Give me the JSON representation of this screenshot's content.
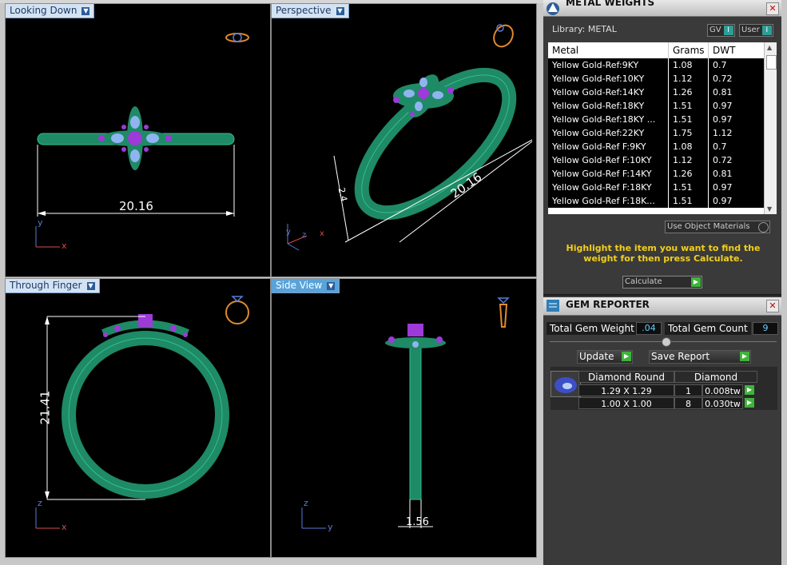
{
  "viewports": [
    {
      "label": "Looking Down",
      "active": false,
      "dimension": "20.16",
      "axes": [
        "y",
        "x"
      ]
    },
    {
      "label": "Perspective",
      "active": false,
      "dimension_a": "20.16",
      "dimension_b": "2.4",
      "axes": [
        "y",
        "z",
        "x"
      ]
    },
    {
      "label": "Through Finger",
      "active": false,
      "dimension": "21.41",
      "axes": [
        "z",
        "x"
      ]
    },
    {
      "label": "Side View",
      "active": true,
      "dimension": "1.56",
      "axes": [
        "z",
        "y"
      ]
    }
  ],
  "metal_panel": {
    "title": "METAL WEIGHTS",
    "library_label": "Library: METAL",
    "toggle_gv": "GV",
    "toggle_user": "User",
    "columns": [
      "Metal",
      "Grams",
      "DWT"
    ],
    "rows": [
      [
        "Yellow Gold-Ref:9KY",
        "1.08",
        "0.7"
      ],
      [
        "Yellow Gold-Ref:10KY",
        "1.12",
        "0.72"
      ],
      [
        "Yellow Gold-Ref:14KY",
        "1.26",
        "0.81"
      ],
      [
        "Yellow Gold-Ref:18KY",
        "1.51",
        "0.97"
      ],
      [
        "Yellow Gold-Ref:18KY ...",
        "1.51",
        "0.97"
      ],
      [
        "Yellow Gold-Ref:22KY",
        "1.75",
        "1.12"
      ],
      [
        "Yellow Gold-Ref F:9KY",
        "1.08",
        "0.7"
      ],
      [
        "Yellow Gold-Ref F:10KY",
        "1.12",
        "0.72"
      ],
      [
        "Yellow Gold-Ref F:14KY",
        "1.26",
        "0.81"
      ],
      [
        "Yellow Gold-Ref F:18KY",
        "1.51",
        "0.97"
      ],
      [
        "Yellow Gold-Ref F:18K...",
        "1.51",
        "0.97"
      ]
    ],
    "use_object_materials": "Use Object Materials",
    "hint": "Highlight the item you want to find the weight for then press Calculate.",
    "calculate_label": "Calculate"
  },
  "gem_panel": {
    "title": "GEM REPORTER",
    "total_weight_label": "Total Gem Weight",
    "total_weight_value": ".04",
    "total_count_label": "Total Gem Count",
    "total_count_value": "9",
    "update_label": "Update",
    "save_report_label": "Save Report",
    "header_shape": "Diamond Round",
    "header_material": "Diamond",
    "rows": [
      {
        "size": "1.29 X 1.29",
        "count": "1",
        "weight": "0.008tw"
      },
      {
        "size": "1.00 X 1.00",
        "count": "8",
        "weight": "0.030tw"
      }
    ]
  },
  "colors": {
    "ring": "#1f8a66",
    "gem_blue": "#8fb5f0",
    "gem_purple": "#9d3ad8",
    "dimension": "#ffffff",
    "hint": "#f2d01a"
  }
}
